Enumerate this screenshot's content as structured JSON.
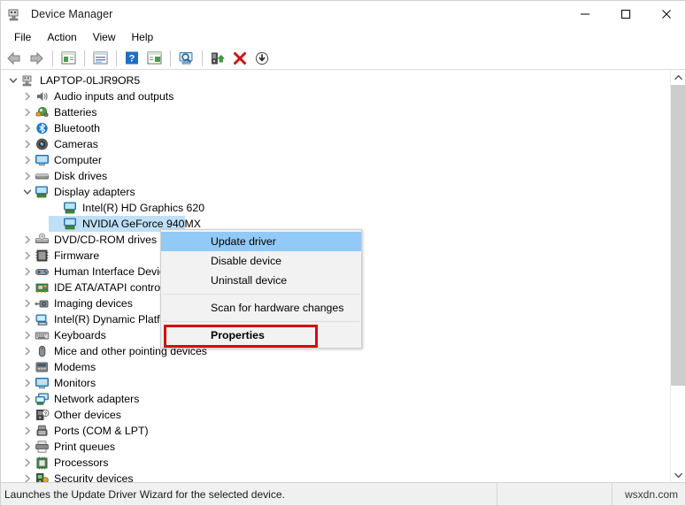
{
  "window": {
    "title": "Device Manager",
    "icon": "device-manager-icon",
    "controls": {
      "minimize": "minimize-icon",
      "maximize": "maximize-icon",
      "close": "close-icon"
    }
  },
  "menubar": {
    "items": [
      {
        "label": "File"
      },
      {
        "label": "Action"
      },
      {
        "label": "View"
      },
      {
        "label": "Help"
      }
    ]
  },
  "toolbar": {
    "buttons": [
      {
        "name": "back-icon"
      },
      {
        "name": "forward-icon"
      },
      {
        "name": "show-hide-console-tree-icon"
      },
      {
        "name": "properties-icon"
      },
      {
        "name": "help-icon"
      },
      {
        "name": "show-hide-action-pane-icon"
      },
      {
        "name": "scan-for-hardware-changes-icon"
      },
      {
        "name": "update-driver-icon"
      },
      {
        "name": "disable-device-icon"
      },
      {
        "name": "uninstall-device-icon"
      }
    ]
  },
  "tree": {
    "root": {
      "label": "LAPTOP-0LJR9OR5",
      "icon": "computer-icon",
      "expanded": true
    },
    "items": [
      {
        "label": "Audio inputs and outputs",
        "icon": "speaker-icon",
        "level": 1,
        "expandable": true
      },
      {
        "label": "Batteries",
        "icon": "battery-icon",
        "level": 1,
        "expandable": true
      },
      {
        "label": "Bluetooth",
        "icon": "bluetooth-icon",
        "level": 1,
        "expandable": true
      },
      {
        "label": "Cameras",
        "icon": "camera-icon",
        "level": 1,
        "expandable": true
      },
      {
        "label": "Computer",
        "icon": "monitor-icon",
        "level": 1,
        "expandable": true
      },
      {
        "label": "Disk drives",
        "icon": "disk-drive-icon",
        "level": 1,
        "expandable": true
      },
      {
        "label": "Display adapters",
        "icon": "display-adapter-icon",
        "level": 1,
        "expandable": true,
        "expanded": true
      },
      {
        "label": "Intel(R) HD Graphics 620",
        "icon": "display-adapter-icon",
        "level": 2,
        "expandable": false
      },
      {
        "label": "NVIDIA GeForce 940MX",
        "icon": "display-adapter-icon",
        "level": 2,
        "expandable": false,
        "selected": true
      },
      {
        "label": "DVD/CD-ROM drives",
        "icon": "dvd-drive-icon",
        "level": 1,
        "expandable": true
      },
      {
        "label": "Firmware",
        "icon": "firmware-icon",
        "level": 1,
        "expandable": true
      },
      {
        "label": "Human Interface Devices",
        "icon": "hid-icon",
        "level": 1,
        "expandable": true
      },
      {
        "label": "IDE ATA/ATAPI controllers",
        "icon": "ide-controller-icon",
        "level": 1,
        "expandable": true
      },
      {
        "label": "Imaging devices",
        "icon": "imaging-device-icon",
        "level": 1,
        "expandable": true
      },
      {
        "label": "Intel(R) Dynamic Platform and Thermal Framework",
        "icon": "intel-platform-icon",
        "level": 1,
        "expandable": true
      },
      {
        "label": "Keyboards",
        "icon": "keyboard-icon",
        "level": 1,
        "expandable": true
      },
      {
        "label": "Mice and other pointing devices",
        "icon": "mouse-icon",
        "level": 1,
        "expandable": true
      },
      {
        "label": "Modems",
        "icon": "modem-icon",
        "level": 1,
        "expandable": true
      },
      {
        "label": "Monitors",
        "icon": "monitor-icon",
        "level": 1,
        "expandable": true
      },
      {
        "label": "Network adapters",
        "icon": "network-adapter-icon",
        "level": 1,
        "expandable": true
      },
      {
        "label": "Other devices",
        "icon": "other-device-icon",
        "level": 1,
        "expandable": true
      },
      {
        "label": "Ports (COM & LPT)",
        "icon": "port-icon",
        "level": 1,
        "expandable": true
      },
      {
        "label": "Print queues",
        "icon": "printer-icon",
        "level": 1,
        "expandable": true
      },
      {
        "label": "Processors",
        "icon": "processor-icon",
        "level": 1,
        "expandable": true
      },
      {
        "label": "Security devices",
        "icon": "security-device-icon",
        "level": 1,
        "expandable": true
      }
    ]
  },
  "context_menu": {
    "items": [
      {
        "label": "Update driver",
        "highlighted": true,
        "bold": false,
        "separator_after": false
      },
      {
        "label": "Disable device",
        "highlighted": false,
        "bold": false,
        "separator_after": false
      },
      {
        "label": "Uninstall device",
        "highlighted": false,
        "bold": false,
        "separator_after": true
      },
      {
        "label": "Scan for hardware changes",
        "highlighted": false,
        "bold": false,
        "separator_after": true
      },
      {
        "label": "Properties",
        "highlighted": false,
        "bold": true,
        "separator_after": false
      }
    ],
    "annotation_color": "#d60b0b",
    "highlight_color": "#91c9f7"
  },
  "statusbar": {
    "message": "Launches the Update Driver Wizard for the selected device.",
    "panel2": "",
    "watermark": "wsxdn.com"
  }
}
